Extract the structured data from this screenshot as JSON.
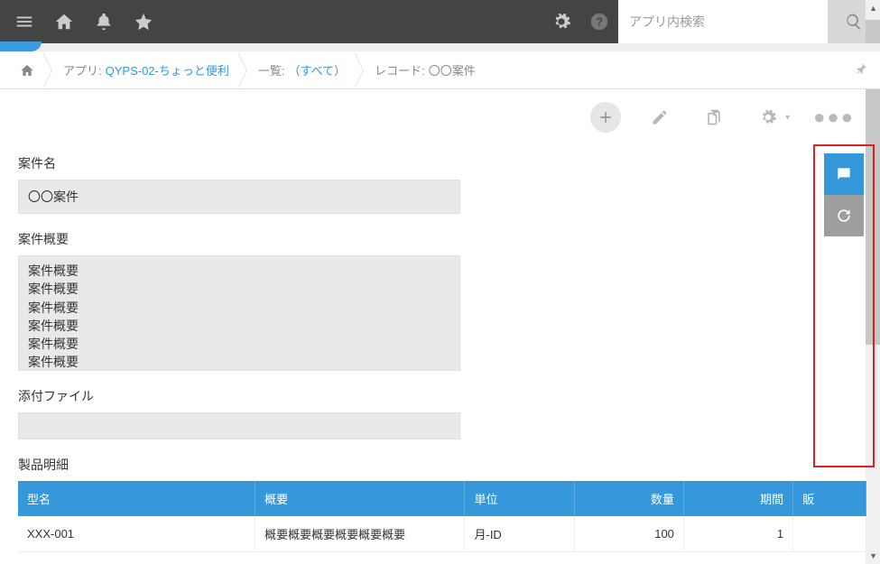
{
  "header": {
    "search_placeholder": "アプリ内検索"
  },
  "breadcrumb": {
    "app_prefix": "アプリ: ",
    "app_name": "QYPS-02-ちょっと便利",
    "view_prefix": "一覧: ",
    "view_name": "（すべて）",
    "record_prefix": "レコード: ",
    "record_name": "〇〇案件"
  },
  "fields": {
    "case_name": {
      "label": "案件名",
      "value": "〇〇案件"
    },
    "case_summary": {
      "label": "案件概要",
      "lines": [
        "案件概要",
        "案件概要",
        "案件概要",
        "案件概要",
        "案件概要",
        "案件概要"
      ]
    },
    "attachment": {
      "label": "添付ファイル"
    },
    "product_detail": {
      "label": "製品明細"
    }
  },
  "table": {
    "headers": {
      "model": "型名",
      "summary": "概要",
      "unit": "単位",
      "qty": "数量",
      "period": "期間",
      "sale": "販"
    },
    "rows": [
      {
        "model": "XXX-001",
        "summary": "概要概要概要概要概要概要",
        "unit": "月-ID",
        "qty": "100",
        "period": "1"
      }
    ]
  }
}
